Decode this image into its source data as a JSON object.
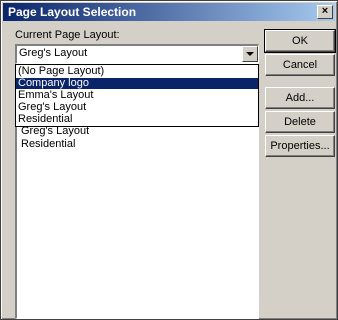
{
  "window": {
    "title": "Page Layout Selection",
    "close_glyph": "×"
  },
  "current_label": "Current Page Layout:",
  "combo": {
    "value": "Greg's Layout"
  },
  "list_items": [
    "Greg's Layout",
    "Residential"
  ],
  "dropdown_options": [
    {
      "label": "(No Page Layout)",
      "selected": false
    },
    {
      "label": "Company logo",
      "selected": true
    },
    {
      "label": "Emma's Layout",
      "selected": false
    },
    {
      "label": "Greg's Layout",
      "selected": false
    },
    {
      "label": "Residential",
      "selected": false
    }
  ],
  "buttons": {
    "ok": "OK",
    "cancel": "Cancel",
    "add": "Add...",
    "delete": "Delete",
    "properties": "Properties..."
  },
  "colors": {
    "title_bar": "#0a246a",
    "selection": "#0a246a",
    "face": "#d4d0c8"
  }
}
